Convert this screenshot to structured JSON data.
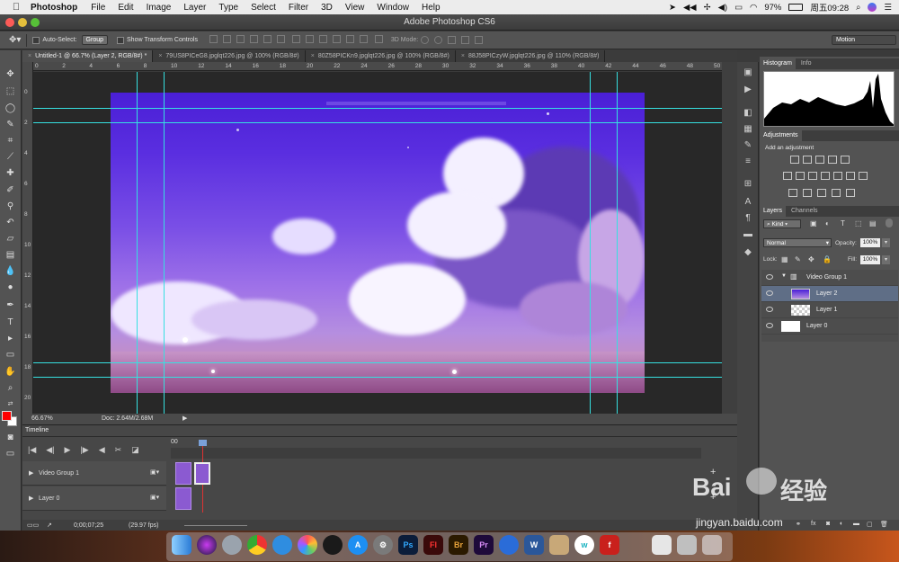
{
  "menubar": {
    "app_name": "Photoshop",
    "items": [
      "File",
      "Edit",
      "Image",
      "Layer",
      "Type",
      "Select",
      "Filter",
      "3D",
      "View",
      "Window",
      "Help"
    ],
    "battery": "97%",
    "clock": "周五09:28"
  },
  "window": {
    "title": "Adobe Photoshop CS6"
  },
  "options": {
    "auto_select_label": "Auto-Select:",
    "auto_select_value": "Group",
    "show_transform_label": "Show Transform Controls",
    "mode_3d_label": "3D Mode:",
    "workspace": "Motion"
  },
  "tabs": [
    {
      "label": "Untitled-1 @ 66.7% (Layer 2, RGB/8#) *",
      "active": true
    },
    {
      "label": "79US8PICeG8.jpglqt226.jpg @ 100% (RGB/8#)",
      "active": false
    },
    {
      "label": "80Z58PICKn9.jpglqt226.jpg @ 100% (RGB/8#)",
      "active": false
    },
    {
      "label": "88J58PICzyW.jpglqt226.jpg @ 110% (RGB/8#)",
      "active": false
    }
  ],
  "ruler_top": [
    "0",
    "2",
    "4",
    "6",
    "8",
    "10",
    "12",
    "14",
    "16",
    "18",
    "20",
    "22",
    "24",
    "26",
    "28",
    "30",
    "32",
    "34",
    "36",
    "38",
    "40",
    "42",
    "44",
    "46",
    "48",
    "50"
  ],
  "ruler_left": [
    "0",
    "2",
    "4",
    "6",
    "8",
    "10",
    "12",
    "14",
    "16",
    "18",
    "20"
  ],
  "status": {
    "zoom": "66.67%",
    "doc": "Doc: 2.64M/2.68M"
  },
  "timeline": {
    "tab": "Timeline",
    "time_marker": "00",
    "tracks": [
      "Video Group 1",
      "Layer 0"
    ],
    "timecode": "0;00;07;25",
    "fps": "(29.97 fps)"
  },
  "panels": {
    "histogram_tab": "Histogram",
    "info_tab": "Info",
    "adjustments_tab": "Adjustments",
    "add_adjustment": "Add an adjustment",
    "layers_tab": "Layers",
    "channels_tab": "Channels",
    "kind": "Kind",
    "blend_mode": "Normal",
    "opacity_label": "Opacity:",
    "opacity_value": "100%",
    "lock_label": "Lock:",
    "fill_label": "Fill:",
    "fill_value": "100%",
    "layers": [
      {
        "name": "Video Group 1",
        "type": "group"
      },
      {
        "name": "Layer 2",
        "type": "image",
        "selected": true
      },
      {
        "name": "Layer 1",
        "type": "transparent"
      },
      {
        "name": "Layer 0",
        "type": "white"
      }
    ]
  },
  "dock": [
    "Finder",
    "Siri",
    "Launchpad",
    "Chrome",
    "Safari",
    "Photos",
    "QQ",
    "App Store",
    "System Preferences",
    "Ps",
    "Fl",
    "Br",
    "Pr",
    "Browser",
    "Word",
    "Archive",
    "Browser W",
    "Flash",
    "Preview",
    "Screenshot",
    "Trash"
  ],
  "watermark": {
    "brand": "Bai",
    "brand2": "经验",
    "url": "jingyan.baidu.com"
  }
}
